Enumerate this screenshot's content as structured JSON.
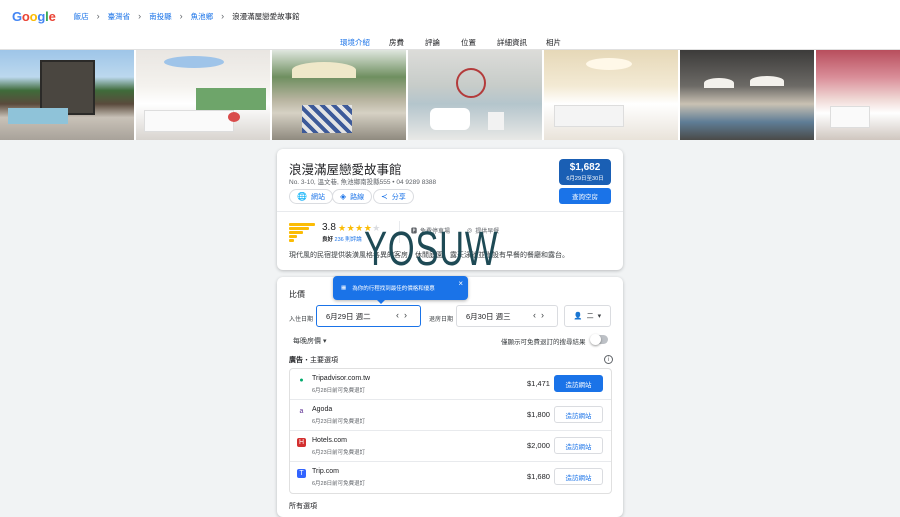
{
  "colors": {
    "accent": "#1a73e8",
    "price_badge": "#1a5fb4",
    "star": "#fbbc05",
    "watermark": "#1e4a55"
  },
  "header": {
    "logo": "Google",
    "breadcrumbs": [
      "飯店",
      "臺灣省",
      "南投縣",
      "魚池鄉",
      "浪漫滿屋戀愛故事館"
    ]
  },
  "tabs": [
    "環境介紹",
    "房費",
    "評論",
    "位置",
    "詳細資訊",
    "相片"
  ],
  "hotel": {
    "name": "浪漫滿屋戀愛故事館",
    "address": "No. 3-10, 溫文巷, 魚池鄉南投縣555 • 04 9289 8388",
    "actions": {
      "website": "網站",
      "directions": "路線",
      "share": "分享"
    },
    "price": "$1,682",
    "price_dates": "6月29日至30日",
    "check_button": "查詢空房",
    "rating": "3.8",
    "stars": 4,
    "rating_label": "良好",
    "reviews": "236 則評論",
    "amenities": [
      "免費停車場",
      "提供早餐"
    ],
    "description": "現代風的民宿提供裝潢風格各異的客房、休閒庭園、露天泳池並附設有早餐的餐廳和露台。"
  },
  "watermark": "YOSUW",
  "compare": {
    "title": "比價",
    "tooltip": "為你的行程找到最佳的價格和優惠",
    "checkin_label": "入住日期",
    "checkin": "6月29日 週二",
    "checkout_label": "退房日期",
    "checkout": "6月30日 週三",
    "guests": "二",
    "price_mode": "每晚房價",
    "free_cancel_only": "僅顯示可免費退訂的搜尋結果",
    "ads_prefix": "廣告",
    "ads_title": "・主要選項",
    "visit_label": "造訪網站",
    "offers": [
      {
        "name": "Tripadvisor.com.tw",
        "note": "6月28日前可免費退訂",
        "price": "$1,471",
        "icon": "tripadvisor-icon",
        "icon_char": "●",
        "icon_color": "#00aa6c"
      },
      {
        "name": "Agoda",
        "note": "6月23日前可免費退訂",
        "price": "$1,800",
        "icon": "agoda-icon",
        "icon_char": "a",
        "icon_color": "#5c2d91"
      },
      {
        "name": "Hotels.com",
        "note": "6月23日前可免費退訂",
        "price": "$2,000",
        "icon": "hotels-com-icon",
        "icon_char": "H",
        "icon_color": "#d32f2f"
      },
      {
        "name": "Trip.com",
        "note": "6月28日前可免費退訂",
        "price": "$1,680",
        "icon": "trip-com-icon",
        "icon_char": "T",
        "icon_color": "#3264ff"
      }
    ],
    "more_options": "所有選項"
  }
}
